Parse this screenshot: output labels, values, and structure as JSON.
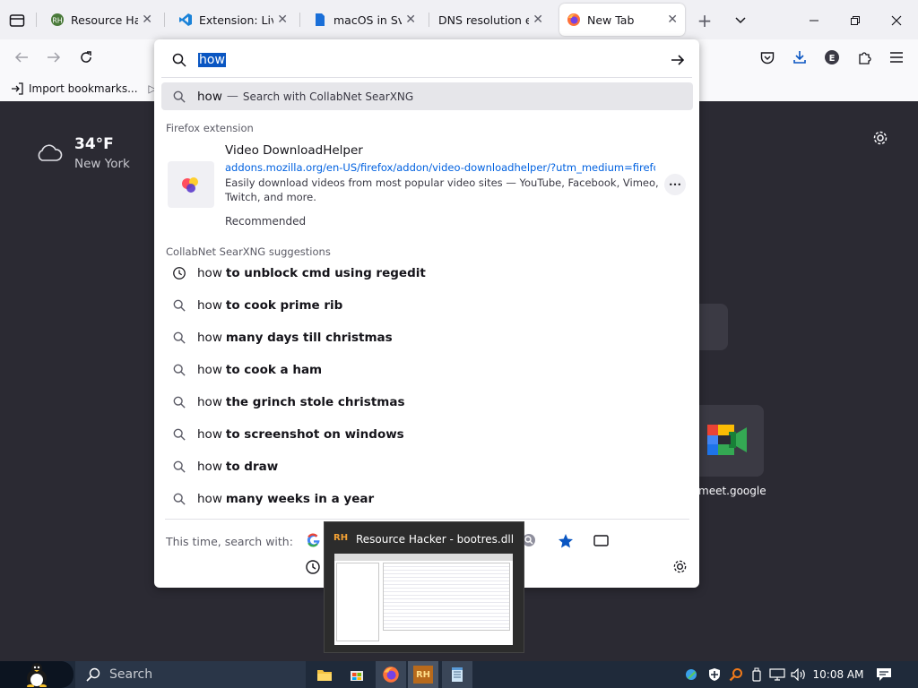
{
  "tabs": [
    {
      "title": "Resource Hacke",
      "icon": "resource-hacker-icon"
    },
    {
      "title": "Extension: Live S",
      "icon": "vscode-icon"
    },
    {
      "title": "macOS in Svelte",
      "icon": "document-icon"
    },
    {
      "title": "DNS resolution error",
      "icon": "none"
    },
    {
      "title": "New Tab",
      "icon": "firefox-icon",
      "active": true
    }
  ],
  "bookmarks": {
    "import_label": "Import bookmarks..."
  },
  "urlbar": {
    "value": "how"
  },
  "search_row": {
    "query": "how",
    "dash": "—",
    "label": "Search with CollabNet SearXNG"
  },
  "extension": {
    "group_label": "Firefox extension",
    "title": "Video DownloadHelper",
    "url": "addons.mozilla.org/en-US/firefox/addon/video-downloadhelper/?utm_medium=firefox-d",
    "desc1": "Easily download videos from most popular video sites — YouTube, Facebook, Vimeo,",
    "desc2": "Twitch, and more.",
    "recommended": "Recommended",
    "menu_label": "•••"
  },
  "suggestions_label": "CollabNet SearXNG suggestions",
  "suggestions": [
    {
      "prefix": "how",
      "rest": "to unblock cmd using regedit",
      "icon": "history-clock-icon"
    },
    {
      "prefix": "how",
      "rest": "to cook prime rib",
      "icon": "search-icon"
    },
    {
      "prefix": "how",
      "rest": "many days till christmas",
      "icon": "search-icon"
    },
    {
      "prefix": "how",
      "rest": "to cook a ham",
      "icon": "search-icon"
    },
    {
      "prefix": "how",
      "rest": "the grinch stole christmas",
      "icon": "search-icon"
    },
    {
      "prefix": "how",
      "rest": "to screenshot on windows",
      "icon": "search-icon"
    },
    {
      "prefix": "how",
      "rest": "to draw",
      "icon": "search-icon"
    },
    {
      "prefix": "how",
      "rest": "many weeks in a year",
      "icon": "search-icon"
    }
  ],
  "search_with": "This time, search with:",
  "weather": {
    "temp": "34°F",
    "city": "New York"
  },
  "shortcut": {
    "label": "meet.google"
  },
  "preview": {
    "title": "Resource Hacker - bootres.dll",
    "logo": "RH"
  },
  "taskbar": {
    "search_placeholder": "Search",
    "time": "10:08 AM",
    "rh_logo": "RH"
  },
  "colors": {
    "accent": "#0a56c2",
    "link": "#0061e0",
    "background": "#2b2a33",
    "taskbar": "#1f2a3a"
  }
}
